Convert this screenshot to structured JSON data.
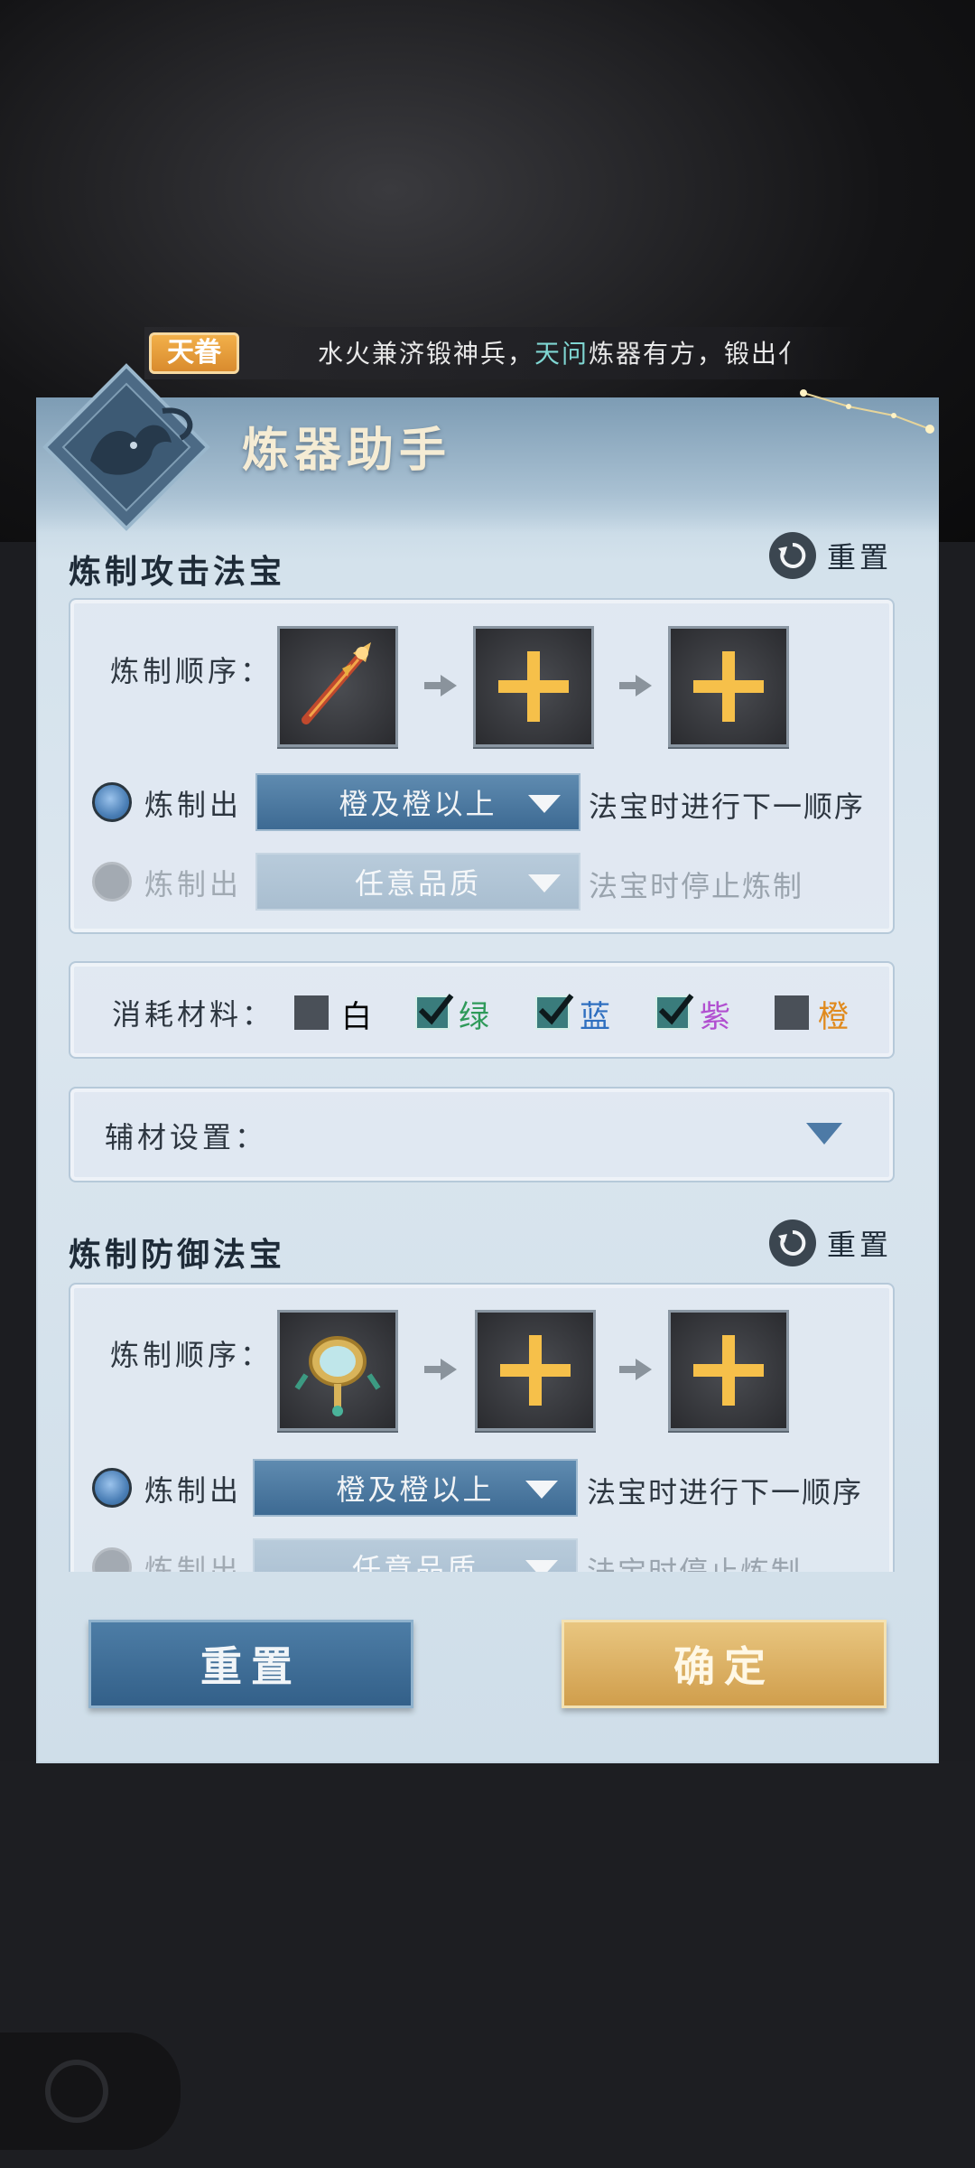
{
  "marquee": {
    "badge": "天眷",
    "text_before": "水火兼济锻神兵，",
    "text_highlight": "天问",
    "text_after": "炼器有方，锻出亻"
  },
  "panel": {
    "title": "炼器助手"
  },
  "attack": {
    "section_title": "炼制攻击法宝",
    "reset_label": "重置",
    "order_label": "炼制顺序：",
    "row1": {
      "prefix": "炼制出",
      "dropdown": "橙及橙以上",
      "suffix": "法宝时进行下一顺序"
    },
    "row2": {
      "prefix": "炼制出",
      "dropdown": "任意品质",
      "suffix": "法宝时停止炼制"
    },
    "materials": {
      "label": "消耗材料：",
      "options": [
        {
          "label": "白",
          "checked": false,
          "color": "#2d3640"
        },
        {
          "label": "绿",
          "checked": true,
          "color": "#2f9a5a"
        },
        {
          "label": "蓝",
          "checked": true,
          "color": "#2f6fc0"
        },
        {
          "label": "紫",
          "checked": true,
          "color": "#b14fd0"
        },
        {
          "label": "橙",
          "checked": false,
          "color": "#e08a1e"
        }
      ]
    },
    "aux": {
      "label": "辅材设置："
    }
  },
  "defense": {
    "section_title": "炼制防御法宝",
    "reset_label": "重置",
    "order_label": "炼制顺序：",
    "row1": {
      "prefix": "炼制出",
      "dropdown": "橙及橙以上",
      "suffix": "法宝时进行下一顺序"
    },
    "row2": {
      "prefix": "炼制出",
      "dropdown": "任意品质",
      "suffix": "法宝时停止炼制"
    }
  },
  "footer": {
    "reset_button": "重置",
    "confirm_button": "确定"
  },
  "icons": [
    "refresh-icon",
    "plus-icon",
    "arrow-right-icon",
    "chevron-down-icon",
    "checkmark-icon",
    "sword-icon",
    "mirror-icon",
    "fox-emblem-icon"
  ]
}
